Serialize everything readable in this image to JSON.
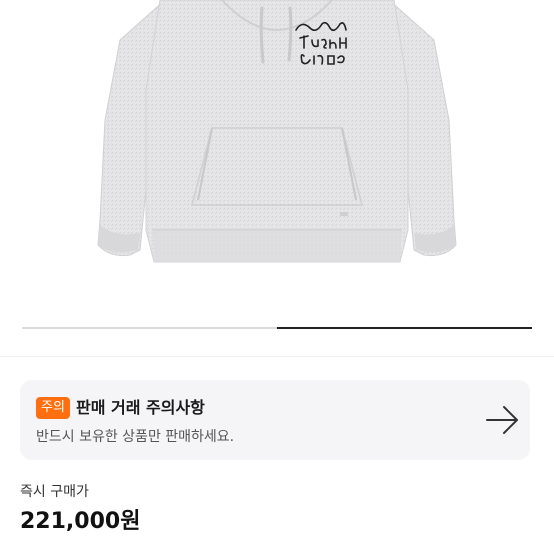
{
  "product": {
    "image_logo_lines": [
      "Stüssy",
      "TOUGH",
      "GEAR"
    ]
  },
  "carousel": {
    "progress": 0.5
  },
  "notice": {
    "badge": "주의",
    "title": "판매 거래 주의사항",
    "text": "반드시 보유한 상품만 판매하세요.",
    "arrow_icon": "arrow-right-icon"
  },
  "price": {
    "label": "즉시 구매가",
    "value": "221,000원"
  },
  "colors": {
    "badge": "#ff6f0f",
    "card_bg": "#f5f5f7",
    "hoodie": "#e3e3e5"
  }
}
